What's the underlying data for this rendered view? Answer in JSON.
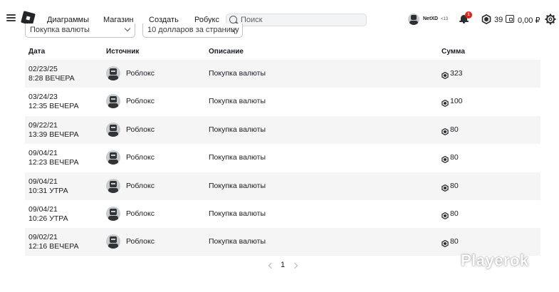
{
  "header": {
    "nav": [
      "Диаграммы",
      "Магазин",
      "Создать",
      "Робукс"
    ],
    "search_placeholder": "Поиск",
    "username": "NetXD",
    "age_label": "<13",
    "notification_count": "1",
    "robux_count": "39",
    "balance": "0,00 ₽"
  },
  "filters": {
    "type_selected": "Покупка валюты",
    "per_page_selected": "10 долларов за страницу"
  },
  "table": {
    "headers": [
      "Дата",
      "Источник",
      "Описание",
      "Сумма"
    ],
    "rows": [
      {
        "date": "02/23/25",
        "time": "8:28 ВЕЧЕРА",
        "source": "Роблокс",
        "description": "Покупка валюты",
        "amount": "323"
      },
      {
        "date": "03/24/23",
        "time": "12:35 ВЕЧЕРА",
        "source": "Роблокс",
        "description": "Покупка валюты",
        "amount": "100"
      },
      {
        "date": "09/22/21",
        "time": "13:39 ВЕЧЕРА",
        "source": "Роблокс",
        "description": "Покупка валюты",
        "amount": "80"
      },
      {
        "date": "09/04/21",
        "time": "12:23 ВЕЧЕРА",
        "source": "Роблокс",
        "description": "Покупка валюты",
        "amount": "80"
      },
      {
        "date": "09/04/21",
        "time": "10:31 УТРА",
        "source": "Роблокс",
        "description": "Покупка валюты",
        "amount": "80"
      },
      {
        "date": "09/04/21",
        "time": "10:26 УТРА",
        "source": "Роблокс",
        "description": "Покупка валюты",
        "amount": "80"
      },
      {
        "date": "09/02/21",
        "time": "12:16 ВЕЧЕРА",
        "source": "Роблокс",
        "description": "Покупка валюты",
        "amount": "80"
      }
    ]
  },
  "pagination": {
    "current_page": "1"
  },
  "watermark": "Playerok",
  "colors": {
    "row_shade": "#f5f5f6",
    "badge_red": "#e2231a",
    "text": "#1a1b1e"
  }
}
